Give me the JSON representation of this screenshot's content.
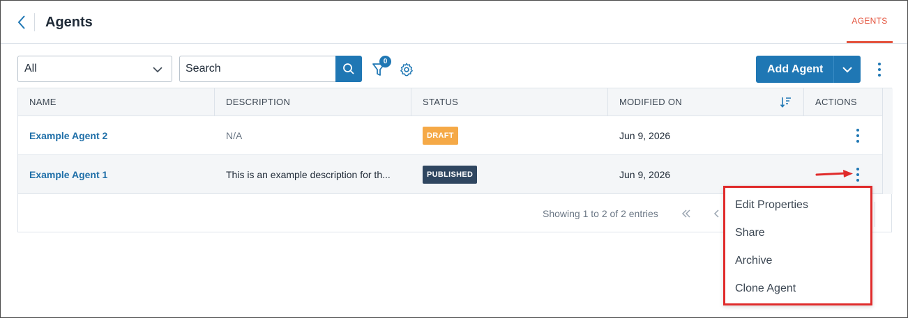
{
  "header": {
    "title": "Agents",
    "tab_label": "AGENTS"
  },
  "toolbar": {
    "filter_select_value": "All",
    "search_placeholder": "Search",
    "filter_count": "0",
    "add_button_label": "Add Agent"
  },
  "table": {
    "columns": [
      "NAME",
      "DESCRIPTION",
      "STATUS",
      "MODIFIED ON",
      "ACTIONS"
    ],
    "rows": [
      {
        "name": "Example Agent 2",
        "description": "N/A",
        "status": "DRAFT",
        "modified_on": "Jun 9, 2026"
      },
      {
        "name": "Example Agent 1",
        "description": "This is an example description for th...",
        "status": "PUBLISHED",
        "modified_on": "Jun 9, 2026"
      }
    ]
  },
  "pagination": {
    "info": "Showing 1 to 2 of 2 entries"
  },
  "context_menu": {
    "items": [
      "Edit Properties",
      "Share",
      "Archive",
      "Clone Agent"
    ]
  },
  "colors": {
    "primary": "#1f77b4",
    "accent_tab": "#e4553f",
    "draft": "#f5a947",
    "published": "#2f4660",
    "highlight": "#e02b2b"
  },
  "icons": {
    "back": "chevron-left-icon",
    "search": "search-icon",
    "filter": "funnel-icon",
    "settings": "gear-icon",
    "sort": "sort-descending-icon",
    "kebab": "vertical-dots-icon"
  }
}
